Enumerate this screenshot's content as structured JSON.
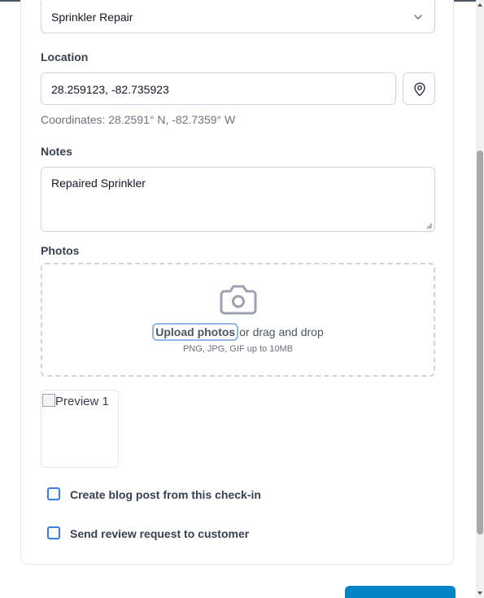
{
  "service": {
    "selected": "Sprinkler Repair"
  },
  "location": {
    "label": "Location",
    "value": "28.259123, -82.735923",
    "coordinates_text": "Coordinates: 28.2591° N, -82.7359° W"
  },
  "notes": {
    "label": "Notes",
    "value": "Repaired Sprinkler"
  },
  "photos": {
    "label": "Photos",
    "upload_link": "Upload photos",
    "drag_text": "or drag and drop",
    "formats": "PNG, JPG, GIF up to 10MB",
    "preview_alt": "Preview 1"
  },
  "options": [
    {
      "label": "Create blog post from this check-in",
      "checked": false
    },
    {
      "label": "Send review request to customer",
      "checked": false
    }
  ],
  "colors": {
    "accent": "#0284c7",
    "checkbox_border": "#3b7dd8",
    "focus_ring": "#93b4e8"
  },
  "icons": {
    "select": "chevron-down-icon",
    "location": "map-pin-icon",
    "upload": "camera-icon"
  }
}
